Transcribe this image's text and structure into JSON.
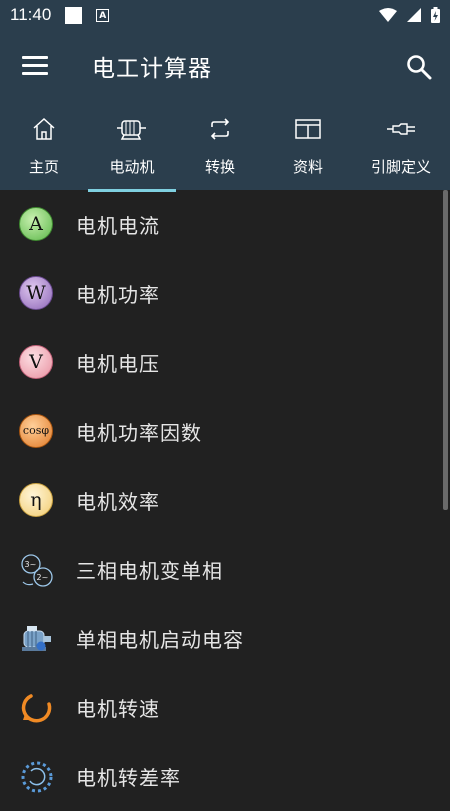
{
  "status": {
    "time": "11:40"
  },
  "app": {
    "title": "电工计算器"
  },
  "tabs": [
    {
      "label": "主页",
      "icon": "home-icon"
    },
    {
      "label": "电动机",
      "icon": "motor-icon"
    },
    {
      "label": "转换",
      "icon": "convert-icon"
    },
    {
      "label": "资料",
      "icon": "book-icon"
    },
    {
      "label": "引脚定义",
      "icon": "pin-icon"
    }
  ],
  "active_tab": "电动机",
  "items": [
    {
      "label": "电机电流",
      "icon": "current-a-icon",
      "symbol": "A"
    },
    {
      "label": "电机功率",
      "icon": "power-w-icon",
      "symbol": "W"
    },
    {
      "label": "电机电压",
      "icon": "voltage-v-icon",
      "symbol": "V"
    },
    {
      "label": "电机功率因数",
      "icon": "cosphi-icon",
      "symbol": "cosφ"
    },
    {
      "label": "电机效率",
      "icon": "efficiency-eta-icon",
      "symbol": "η"
    },
    {
      "label": "三相电机变单相",
      "icon": "three-to-single-phase-icon",
      "symbol": "3~",
      "symbol2": "2~"
    },
    {
      "label": "单相电机启动电容",
      "icon": "motor-capacitor-icon"
    },
    {
      "label": "电机转速",
      "icon": "rotation-speed-icon"
    },
    {
      "label": "电机转差率",
      "icon": "slip-rate-icon"
    }
  ],
  "colors": {
    "appbar": "#2b3e4d",
    "background": "#212121",
    "tab_indicator": "#7fd0e0"
  }
}
